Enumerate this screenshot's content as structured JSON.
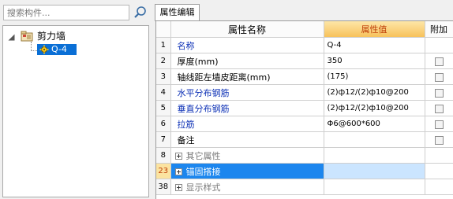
{
  "sidebar": {
    "search_placeholder": "搜索构件...",
    "tree": {
      "root_label": "剪力墙",
      "child_label": "Q-4"
    }
  },
  "panel": {
    "tab_label": "属性编辑",
    "columns": {
      "name": "属性名称",
      "value": "属性值",
      "extra": "附加"
    },
    "rows": [
      {
        "num": "1",
        "name": "名称",
        "value": "Q-4",
        "blue": true,
        "checkbox": false
      },
      {
        "num": "2",
        "name": "厚度(mm)",
        "value": "350",
        "blue": false,
        "checkbox": true
      },
      {
        "num": "3",
        "name": "轴线距左墙皮距离(mm)",
        "value": "(175)",
        "blue": false,
        "checkbox": true
      },
      {
        "num": "4",
        "name": "水平分布钢筋",
        "value": "(2)ф12/(2)ф10@200",
        "blue": true,
        "checkbox": true
      },
      {
        "num": "5",
        "name": "垂直分布钢筋",
        "value": "(2)ф12/(2)ф10@200",
        "blue": true,
        "checkbox": true
      },
      {
        "num": "6",
        "name": "拉筋",
        "value": "Φ6@600*600",
        "blue": true,
        "checkbox": true
      },
      {
        "num": "7",
        "name": "备注",
        "value": "",
        "blue": false,
        "checkbox": true
      }
    ],
    "groups": [
      {
        "num": "8",
        "name": "其它属性"
      },
      {
        "num": "23",
        "name": "锚固搭接"
      },
      {
        "num": "38",
        "name": "显示样式"
      }
    ]
  },
  "colors": {
    "accent": "#0a6fd6",
    "header_value_bg": "#f7c25b",
    "header_value_text": "#c0410a",
    "blue_label": "#0b2fb5"
  }
}
